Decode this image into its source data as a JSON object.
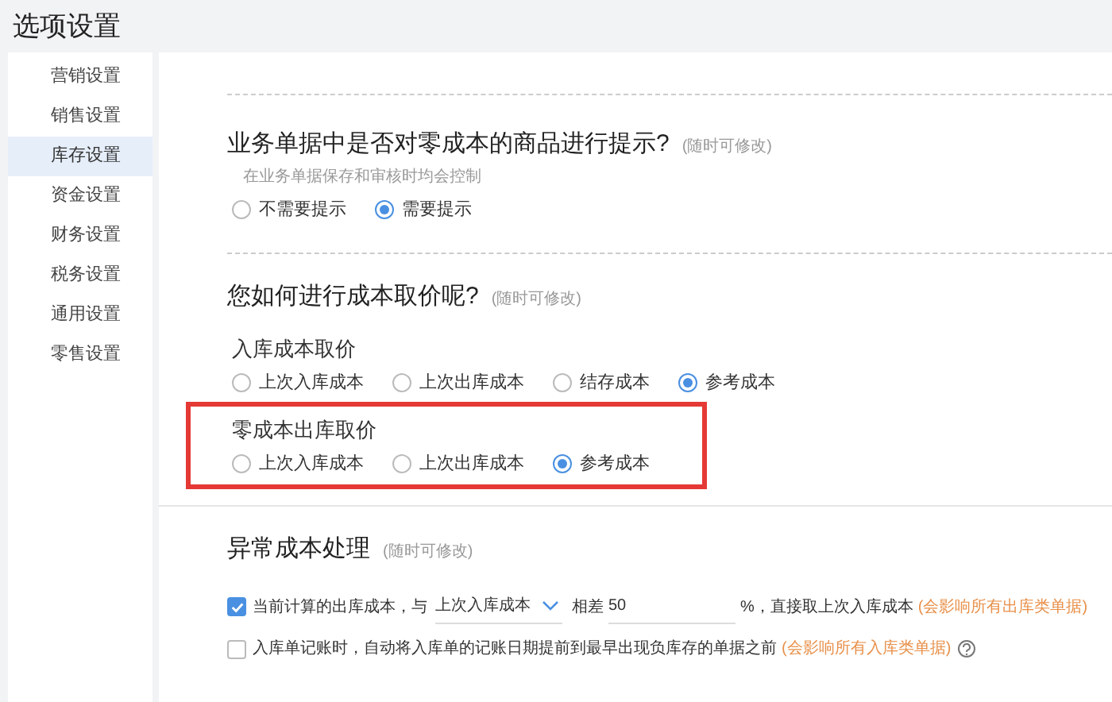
{
  "title": "选项设置",
  "sidebar": {
    "items": [
      {
        "label": "营销设置",
        "selected": false
      },
      {
        "label": "销售设置",
        "selected": false
      },
      {
        "label": "库存设置",
        "selected": true
      },
      {
        "label": "资金设置",
        "selected": false
      },
      {
        "label": "财务设置",
        "selected": false
      },
      {
        "label": "税务设置",
        "selected": false
      },
      {
        "label": "通用设置",
        "selected": false
      },
      {
        "label": "零售设置",
        "selected": false
      }
    ]
  },
  "sections": [
    {
      "title": "业务单据中是否对零成本的商品进行提示?",
      "note": "(随时可修改)",
      "hint": "在业务单据保存和审核时均会控制",
      "groups": [
        {
          "highlighted": false,
          "options": [
            {
              "label": "不需要提示",
              "selected": false
            },
            {
              "label": "需要提示",
              "selected": true
            }
          ]
        }
      ]
    },
    {
      "title": "您如何进行成本取价呢?",
      "note": "(随时可修改)",
      "groups": [
        {
          "label": "入库成本取价",
          "highlighted": false,
          "options": [
            {
              "label": "上次入库成本",
              "selected": false
            },
            {
              "label": "上次出库成本",
              "selected": false
            },
            {
              "label": "结存成本",
              "selected": false
            },
            {
              "label": "参考成本",
              "selected": true
            }
          ]
        },
        {
          "label": "零成本出库取价",
          "highlighted": true,
          "options": [
            {
              "label": "上次入库成本",
              "selected": false
            },
            {
              "label": "上次出库成本",
              "selected": false
            },
            {
              "label": "参考成本",
              "selected": true
            }
          ]
        }
      ]
    },
    {
      "title": "异常成本处理",
      "note": "(随时可修改)",
      "rules": [
        {
          "checked": true,
          "parts": [
            {
              "kind": "text",
              "text": "当前计算的出库成本，与"
            },
            {
              "kind": "select",
              "text": "上次入库成本"
            },
            {
              "kind": "text",
              "text": "相差"
            },
            {
              "kind": "input",
              "text": "50"
            },
            {
              "kind": "text",
              "text": "%，直接取上次入库成本"
            },
            {
              "kind": "warning",
              "text": "(会影响所有出库类单据)"
            }
          ]
        },
        {
          "checked": false,
          "parts": [
            {
              "kind": "text",
              "text": "入库单记账时，自动将入库单的记账日期提前到最早出现负库存的单据之前"
            },
            {
              "kind": "warning",
              "text": "(会影响所有入库类单据)"
            },
            {
              "kind": "help"
            }
          ]
        }
      ]
    }
  ]
}
